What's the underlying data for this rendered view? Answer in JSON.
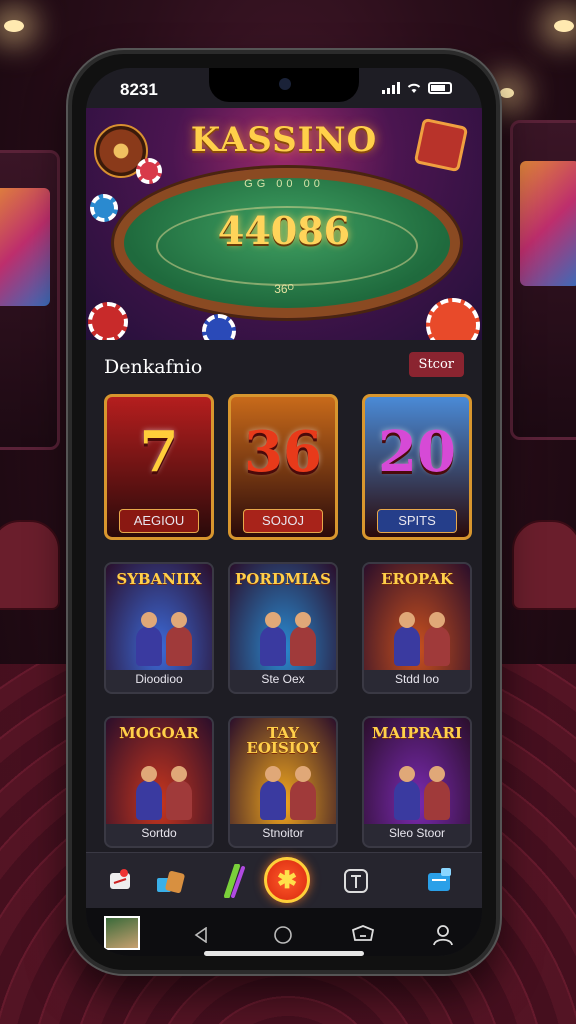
{
  "status_bar": {
    "time": "8231"
  },
  "hero": {
    "title": "KASSINO",
    "table_text": "GG 00 00",
    "jackpot": "44086",
    "sub": "36ᴼ",
    "badge_icon": "dice-badge-icon"
  },
  "section": {
    "title": "Denkafnio",
    "button": "Stcor"
  },
  "slots": [
    {
      "symbol": "7",
      "caption": "AEGIOU",
      "bg": "#b51e1e",
      "cap_bg": "#8a1812",
      "color": "#ffce3a"
    },
    {
      "symbol": "36",
      "caption": "SOJOJ",
      "bg": "#c86a1a",
      "cap_bg": "#a8231a",
      "color": "#e83a1a"
    },
    {
      "symbol": "20",
      "caption": "SPITS",
      "bg": "#4a8ad6",
      "cap_bg": "#253e8a",
      "color": "#d64ad6"
    }
  ],
  "promos_row1": [
    {
      "title": "SYBANIIX",
      "caption": "Dioodioo",
      "bg": "#3c6ad8"
    },
    {
      "title": "PORDMIAS",
      "caption": "Ste Oex",
      "bg": "#2a8ad0"
    },
    {
      "title": "EROPAK",
      "caption": "Stdd loo",
      "bg": "#c8501e"
    }
  ],
  "promos_row2": [
    {
      "title": "MOGOAR",
      "caption": "Sortdo",
      "bg": "#c8361e"
    },
    {
      "title": "TAY EOISIOY",
      "caption": "Stnoitor",
      "bg": "#f2a81e"
    },
    {
      "title": "MAIPRARI",
      "caption": "Sleo Stoor",
      "bg": "#7a2ab0"
    }
  ],
  "tabbar": {
    "items": [
      "ticket-icon",
      "gift-box-icon",
      "slot-icon",
      "home-center-icon",
      "tournament-icon",
      "wallet-icon"
    ],
    "center_symbol": "✱"
  },
  "navbar": {
    "items": [
      "avatar-thumbnail",
      "back-icon",
      "home-circle-icon",
      "notifications-icon",
      "profile-icon"
    ]
  }
}
